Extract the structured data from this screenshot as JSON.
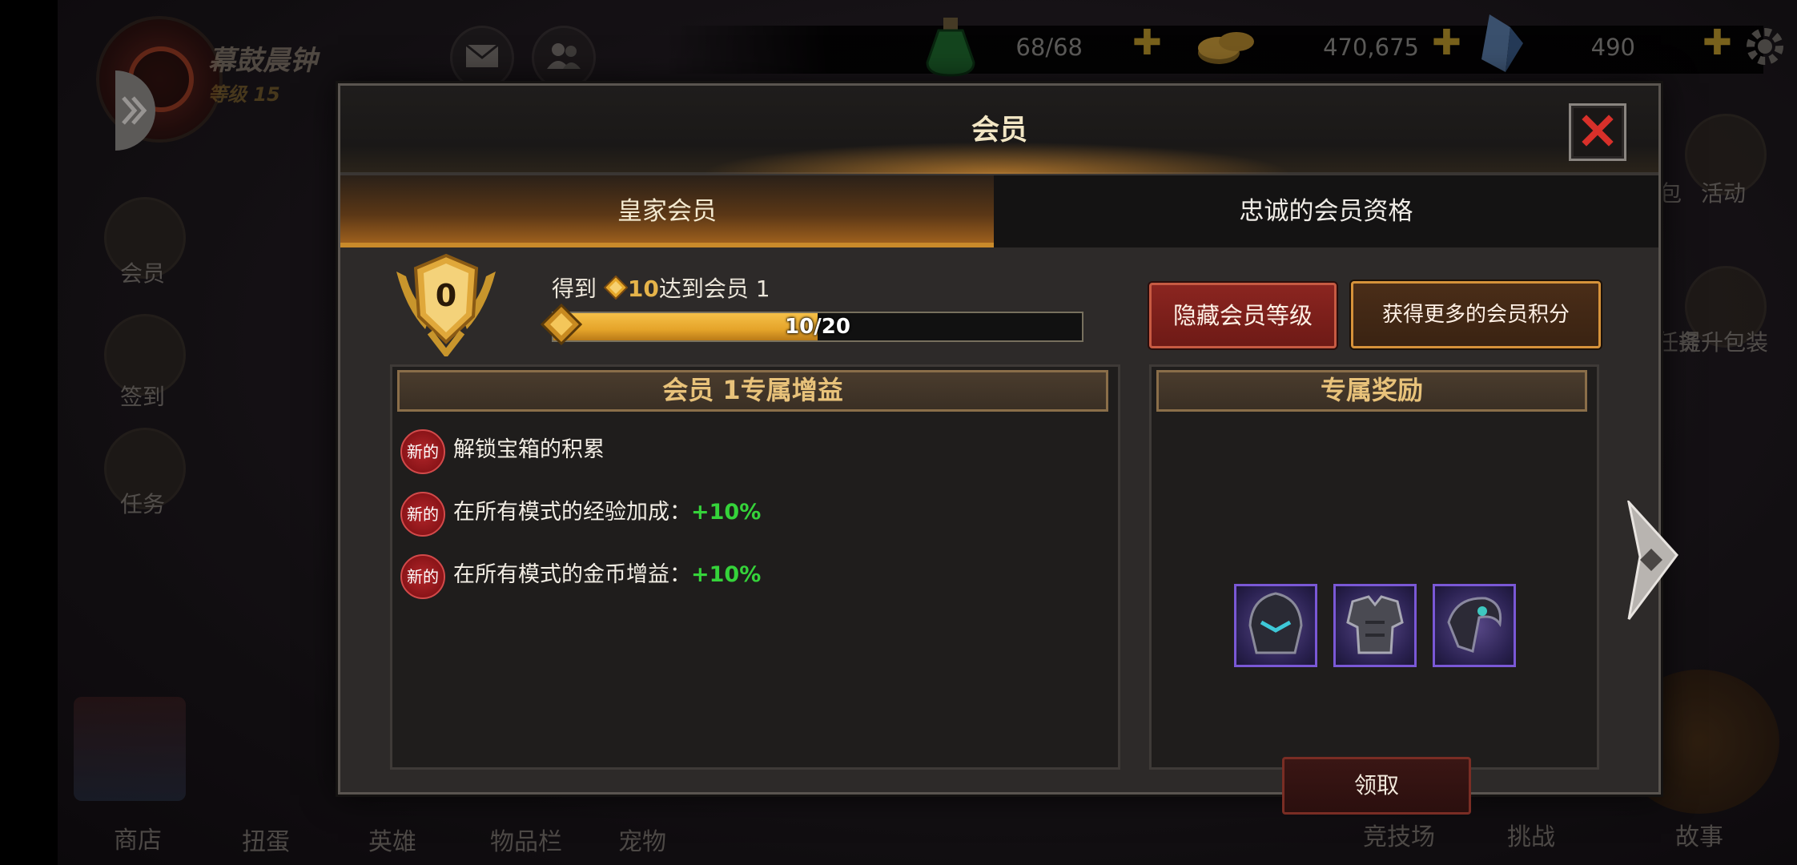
{
  "hud": {
    "player_name": "幕鼓晨钟",
    "player_level": "等级 15",
    "energy": "68/68",
    "gold": "470,675",
    "gems": "490"
  },
  "side_menu": {
    "left": [
      "会员",
      "签到",
      "任务"
    ],
    "right": [
      "礼包",
      "活动",
      "者任务",
      "提升包装"
    ]
  },
  "bottom_nav": {
    "left": [
      "商店",
      "扭蛋",
      "英雄",
      "物品栏",
      "宠物"
    ],
    "right": [
      "竞技场",
      "挑战",
      "故事"
    ]
  },
  "modal": {
    "title": "会员",
    "tabs": [
      "皇家会员",
      "忠诚的会员资格"
    ],
    "active_tab": 0,
    "badge_level": "0",
    "get_prefix": "得到",
    "get_points": "10",
    "get_suffix": "达到会员 1",
    "progress_text": "10/20",
    "progress_fraction": 0.5,
    "hide_button": "隐藏会员等级",
    "more_points_button": "获得更多的会员积分",
    "benefits_title": "会员 1专属增益",
    "new_label": "新的",
    "benefits": [
      {
        "text": "解锁宝箱的积累",
        "bonus": ""
      },
      {
        "text": "在所有模式的经验加成：",
        "bonus": "+10%"
      },
      {
        "text": "在所有模式的金币增益：",
        "bonus": "+10%"
      }
    ],
    "rewards_title": "专属奖励",
    "rewards": [
      "helmet-icon",
      "chest-armor-icon",
      "shoulder-armor-icon"
    ],
    "claim_button": "领取"
  },
  "colors": {
    "accent_gold": "#e6b44a",
    "bonus_green": "#35d33a",
    "hide_red": "#8b2520",
    "reward_border": "#7a58d6"
  }
}
